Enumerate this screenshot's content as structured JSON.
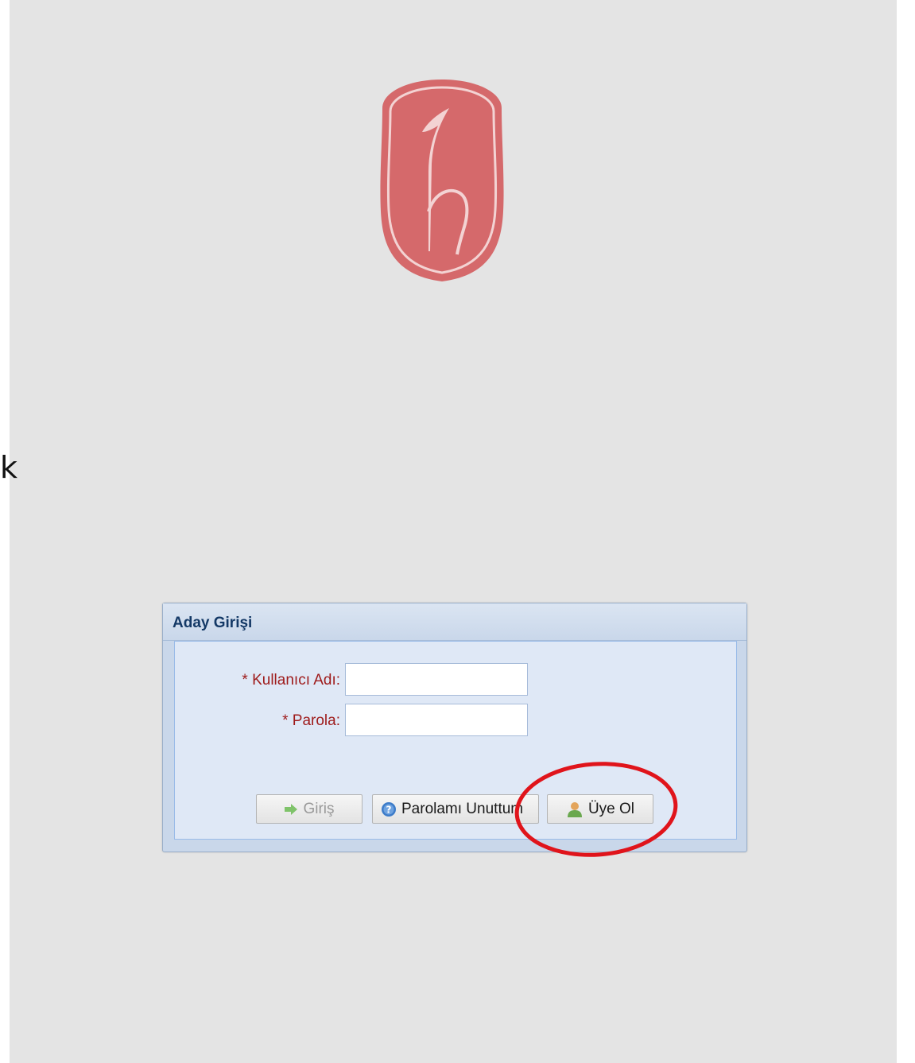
{
  "stray_text": "k",
  "login_panel": {
    "title": "Aday Girişi",
    "username_label": "* Kullanıcı Adı:",
    "password_label": "* Parola:",
    "username_value": "",
    "password_value": "",
    "buttons": {
      "login": "Giriş",
      "forgot_password": "Parolamı Unuttum",
      "register": "Üye Ol"
    }
  },
  "icons": {
    "login": "arrow-right-icon",
    "forgot_password": "help-icon",
    "register": "user-icon"
  },
  "colors": {
    "logo": "#d5696b",
    "label": "#9e1a1a",
    "title": "#143966",
    "annotation": "#e0141b"
  }
}
